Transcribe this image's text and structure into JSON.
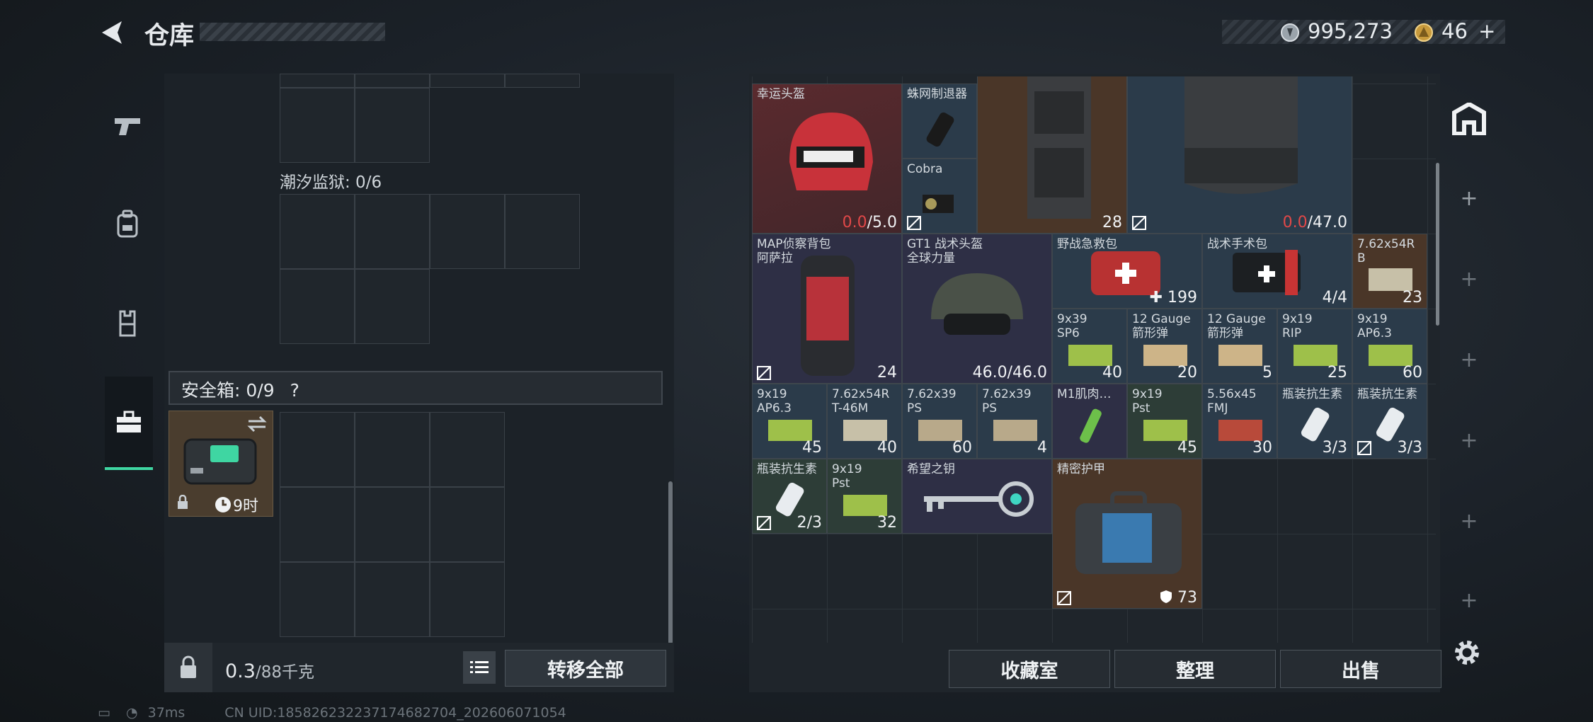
{
  "header": {
    "title": "仓库"
  },
  "currency": {
    "coins": "995,273",
    "gold": "46",
    "gold_plus": "+"
  },
  "left_tabs": [
    "pistol",
    "backpack",
    "vest",
    "safebox"
  ],
  "left_panel": {
    "prison_label": "潮汐监狱: 0/6",
    "safe_label": "安全箱: 0/9",
    "safe_help": "?",
    "safe_timer": "9时",
    "weight_value": "0.3",
    "weight_total": "/88千克",
    "transfer_all": "转移全部"
  },
  "items": [
    {
      "name": "幸运头盔",
      "count_a": "0.0",
      "count_b": "/5.0"
    },
    {
      "name": "蛛网制退器",
      "count": ""
    },
    {
      "name": "Cobra",
      "count": ""
    },
    {
      "name": "",
      "count": "28"
    },
    {
      "name": "",
      "count_a": "0.0",
      "count_b": "/47.0"
    },
    {
      "name": "MAP侦察背包\n阿萨拉",
      "count": "24"
    },
    {
      "name": "GT1 战术头盔\n全球力量",
      "count": "46.0/46.0"
    },
    {
      "name": "野战急救包",
      "count": "199"
    },
    {
      "name": "战术手术包",
      "count": "4/4"
    },
    {
      "name": "7.62x54R\nB",
      "count": "23"
    },
    {
      "name": "9x39\nSP6",
      "count": "40"
    },
    {
      "name": "12 Gauge\n箭形弹",
      "count": "20"
    },
    {
      "name": "12 Gauge\n箭形弹",
      "count": "5"
    },
    {
      "name": "9x19\nRIP",
      "count": "25"
    },
    {
      "name": "9x19\nAP6.3",
      "count": "60"
    },
    {
      "name": "9x19\nAP6.3",
      "count": "45"
    },
    {
      "name": "7.62x54R\nT-46M",
      "count": "40"
    },
    {
      "name": "7.62x39\nPS",
      "count": "60"
    },
    {
      "name": "7.62x39\nPS",
      "count": "4"
    },
    {
      "name": "M1肌肉…",
      "count": ""
    },
    {
      "name": "9x19\nPst",
      "count": "45"
    },
    {
      "name": "5.56x45\nFMJ",
      "count": "30"
    },
    {
      "name": "瓶装抗生素",
      "count": "3/3"
    },
    {
      "name": "瓶装抗生素",
      "count": "3/3"
    },
    {
      "name": "瓶装抗生素",
      "count": "2/3"
    },
    {
      "name": "9x19\nPst",
      "count": "32"
    },
    {
      "name": "希望之钥",
      "count": ""
    },
    {
      "name": "精密护甲",
      "count": "73"
    }
  ],
  "bottom_buttons": {
    "collection": "收藏室",
    "organize": "整理",
    "sell": "出售"
  },
  "footer": {
    "ping": "37ms",
    "uid": "CN UID:185826232237174682704_202606071054"
  }
}
